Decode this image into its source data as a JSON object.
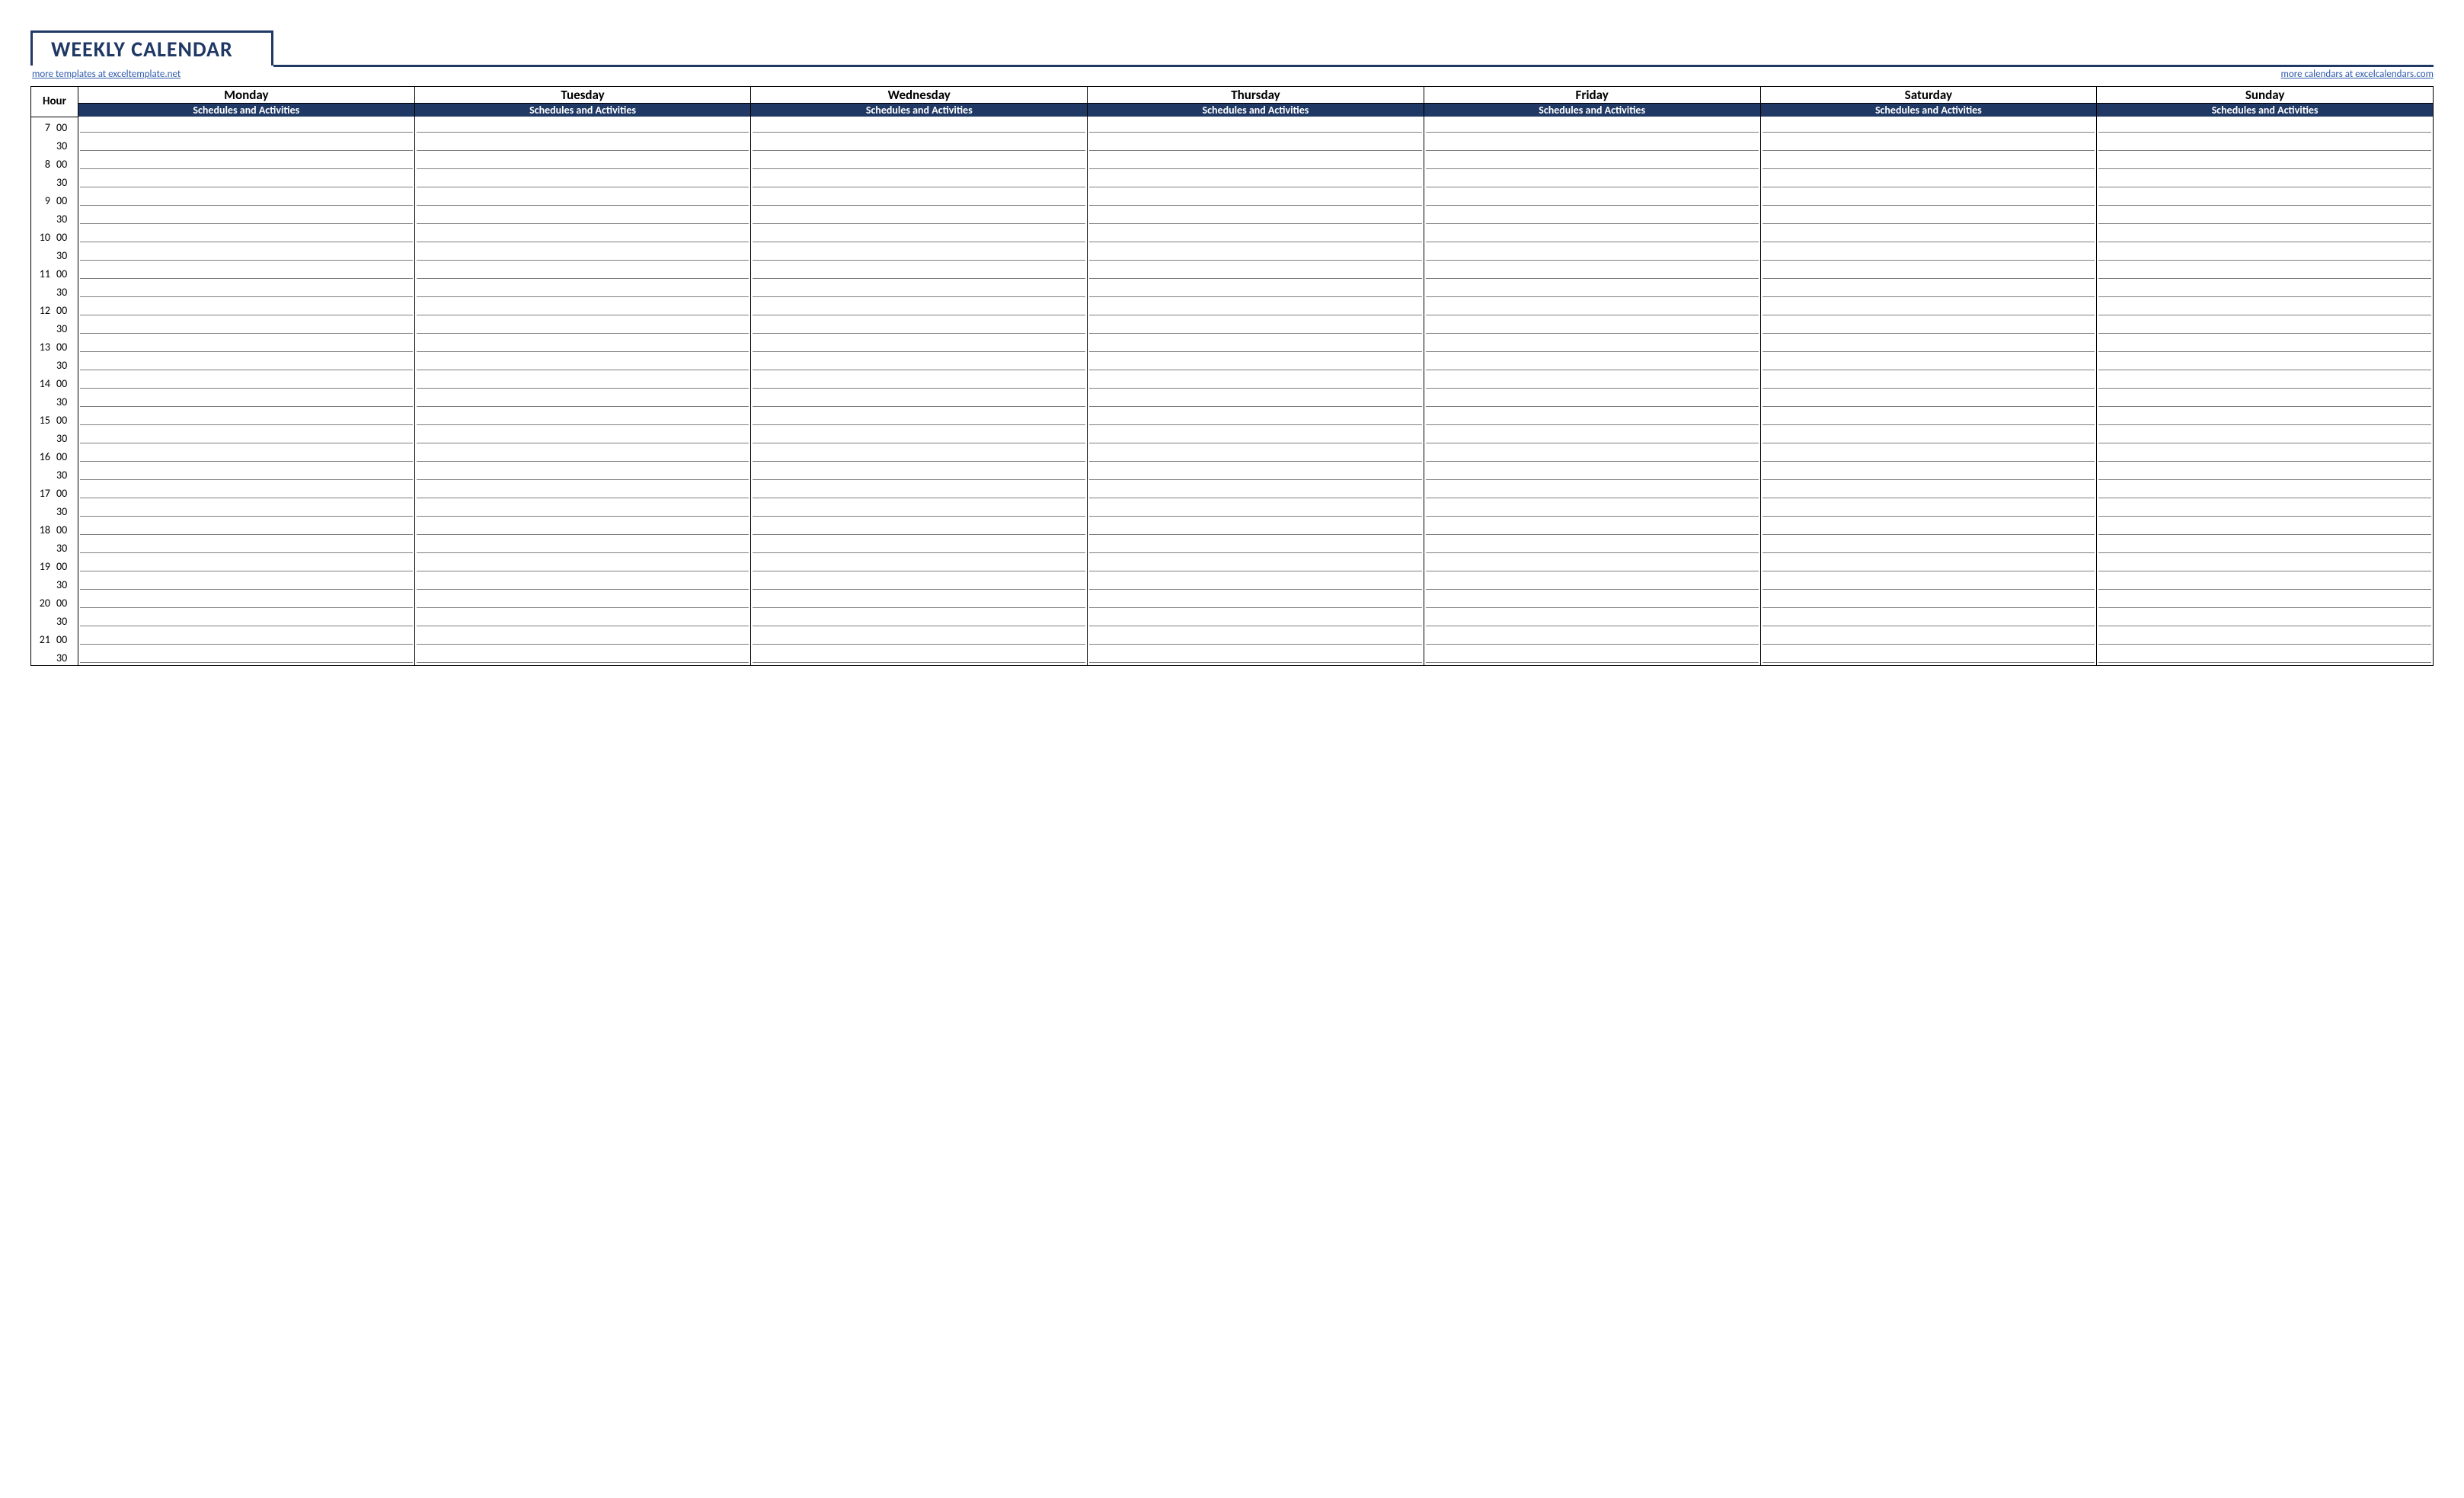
{
  "title": "WEEKLY CALENDAR",
  "links": {
    "left": "more templates at exceltemplate.net",
    "right": "more calendars at excelcalendars.com"
  },
  "headers": {
    "hour": "Hour",
    "sub": "Schedules and Activities"
  },
  "days": [
    "Monday",
    "Tuesday",
    "Wednesday",
    "Thursday",
    "Friday",
    "Saturday",
    "Sunday"
  ],
  "time_rows": [
    {
      "hour": "7",
      "min": "00"
    },
    {
      "hour": "",
      "min": "30"
    },
    {
      "hour": "8",
      "min": "00"
    },
    {
      "hour": "",
      "min": "30"
    },
    {
      "hour": "9",
      "min": "00"
    },
    {
      "hour": "",
      "min": "30"
    },
    {
      "hour": "10",
      "min": "00"
    },
    {
      "hour": "",
      "min": "30"
    },
    {
      "hour": "11",
      "min": "00"
    },
    {
      "hour": "",
      "min": "30"
    },
    {
      "hour": "12",
      "min": "00"
    },
    {
      "hour": "",
      "min": "30"
    },
    {
      "hour": "13",
      "min": "00"
    },
    {
      "hour": "",
      "min": "30"
    },
    {
      "hour": "14",
      "min": "00"
    },
    {
      "hour": "",
      "min": "30"
    },
    {
      "hour": "15",
      "min": "00"
    },
    {
      "hour": "",
      "min": "30"
    },
    {
      "hour": "16",
      "min": "00"
    },
    {
      "hour": "",
      "min": "30"
    },
    {
      "hour": "17",
      "min": "00"
    },
    {
      "hour": "",
      "min": "30"
    },
    {
      "hour": "18",
      "min": "00"
    },
    {
      "hour": "",
      "min": "30"
    },
    {
      "hour": "19",
      "min": "00"
    },
    {
      "hour": "",
      "min": "30"
    },
    {
      "hour": "20",
      "min": "00"
    },
    {
      "hour": "",
      "min": "30"
    },
    {
      "hour": "21",
      "min": "00"
    },
    {
      "hour": "",
      "min": "30"
    }
  ]
}
